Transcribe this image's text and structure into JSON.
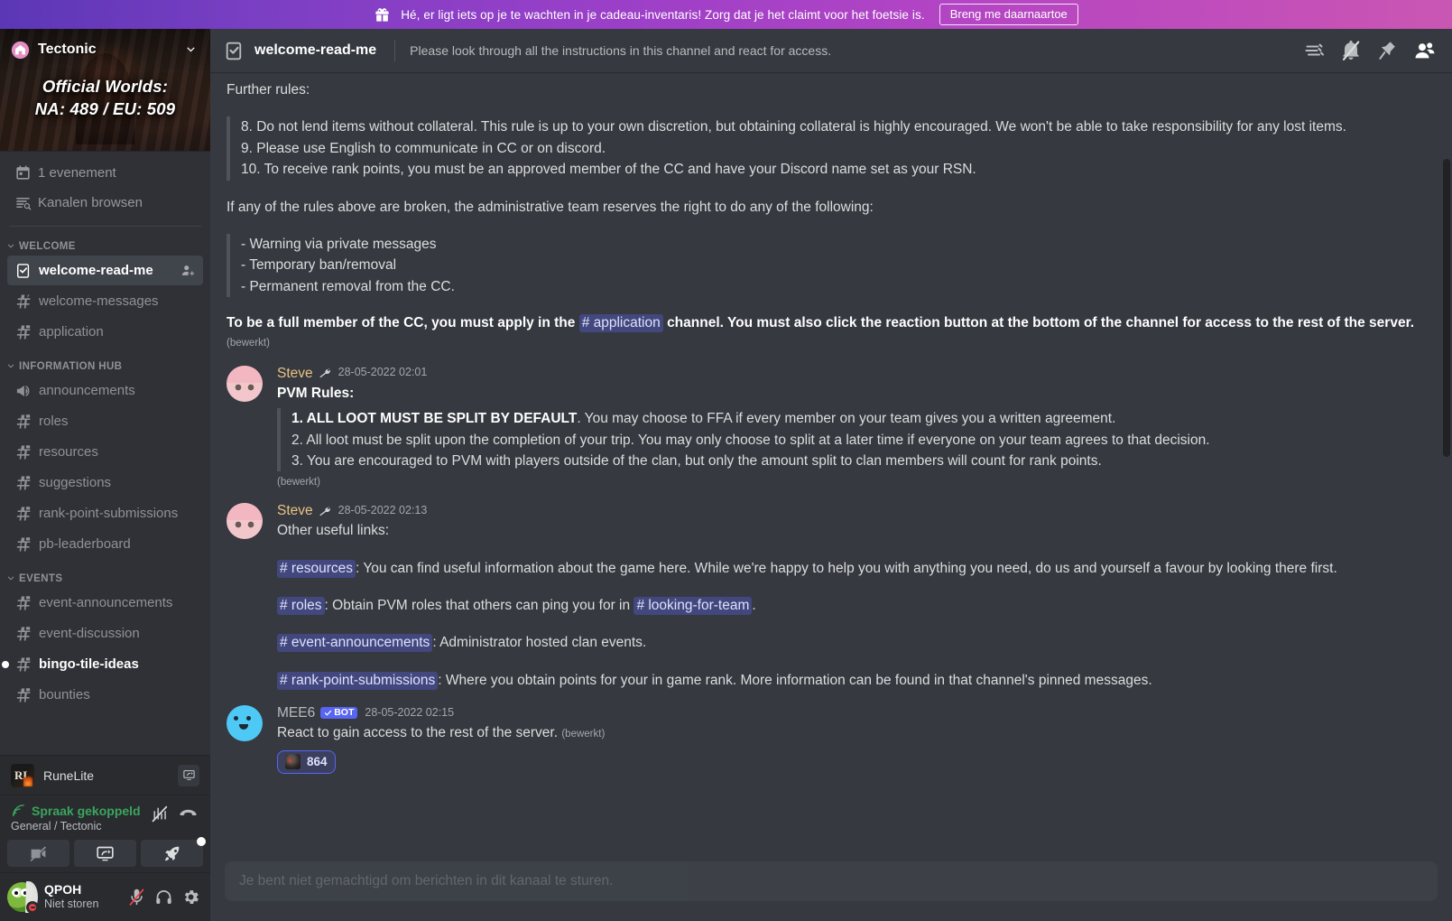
{
  "promo": {
    "icon": "gift-icon",
    "text": "Hé, er ligt iets op je te wachten in je cadeau-inventaris! Zorg dat je het claimt voor het foetsie is.",
    "button_label": "Breng me daarnaartoe"
  },
  "sidebar": {
    "guild_name": "Tectonic",
    "banner_overlay_line1": "Official Worlds:",
    "banner_overlay_line2": "NA: 489 / EU: 509",
    "nav": [
      {
        "label": "1 evenement",
        "icon": "calendar-icon"
      },
      {
        "label": "Kanalen browsen",
        "icon": "browse-channels-icon"
      }
    ],
    "categories": [
      {
        "name": "WELCOME",
        "channels": [
          {
            "label": "welcome-read-me",
            "icon": "rules-channel-icon",
            "active": true,
            "unread": false,
            "trailing_icon": "add-member-icon"
          },
          {
            "label": "welcome-messages",
            "icon": "hash-icon",
            "active": false,
            "unread": false
          },
          {
            "label": "application",
            "icon": "hash-locked-icon",
            "active": false,
            "unread": false
          }
        ]
      },
      {
        "name": "INFORMATION HUB",
        "channels": [
          {
            "label": "announcements",
            "icon": "announcement-icon",
            "active": false,
            "unread": false
          },
          {
            "label": "roles",
            "icon": "hash-locked-icon",
            "active": false,
            "unread": false
          },
          {
            "label": "resources",
            "icon": "hash-locked-icon",
            "active": false,
            "unread": false
          },
          {
            "label": "suggestions",
            "icon": "hash-locked-icon",
            "active": false,
            "unread": false
          },
          {
            "label": "rank-point-submissions",
            "icon": "hash-locked-icon",
            "active": false,
            "unread": false
          },
          {
            "label": "pb-leaderboard",
            "icon": "hash-locked-icon",
            "active": false,
            "unread": false
          }
        ]
      },
      {
        "name": "EVENTS",
        "channels": [
          {
            "label": "event-announcements",
            "icon": "hash-locked-icon",
            "active": false,
            "unread": false
          },
          {
            "label": "event-discussion",
            "icon": "hash-locked-icon",
            "active": false,
            "unread": false
          },
          {
            "label": "bingo-tile-ideas",
            "icon": "hash-locked-icon",
            "active": false,
            "unread": true
          },
          {
            "label": "bounties",
            "icon": "hash-locked-icon",
            "active": false,
            "unread": false
          }
        ]
      }
    ],
    "activity": {
      "name": "RuneLite",
      "action_icon": "popout-icon"
    },
    "voice": {
      "status": "Spraak gekoppeld",
      "channel": "General / Tectonic",
      "icons": [
        "signal-off-icon",
        "disconnect-icon"
      ],
      "buttons": [
        "video-off-icon",
        "screenshare-icon",
        "activity-rocket-icon"
      ]
    },
    "user": {
      "name": "QPOH",
      "status": "Niet storen",
      "icons": [
        "mic-muted-icon",
        "headphones-icon",
        "settings-gear-icon"
      ]
    }
  },
  "header": {
    "channel_icon": "rules-channel-icon",
    "channel_name": "welcome-read-me",
    "topic": "Please look through all the instructions in this channel and react for access.",
    "tools": [
      "threads-icon",
      "notifications-muted-icon",
      "pinned-messages-icon",
      "member-list-icon"
    ]
  },
  "messages": {
    "top_fragment": {
      "intro": "Further rules:",
      "rules": [
        "8. Do not lend items without collateral. This rule is up to your own discretion, but obtaining collateral is highly encouraged. We won't be able to take responsibility for any lost items.",
        "9. Please use English to communicate in CC or on discord.",
        "10. To receive rank points, you must be an approved member of the CC and have your Discord name set as your RSN."
      ],
      "consequences_intro": "If any of the rules above are broken, the administrative team reserves the right to do any of the following:",
      "consequences": [
        "- Warning via private messages",
        "- Temporary ban/removal",
        "- Permanent removal from the CC."
      ],
      "closing_before_mention": "To be a full member of the CC, you must apply in the",
      "closing_mention": "# application",
      "closing_after_mention": "channel.  You must also click the reaction button at the bottom of the channel for access to the rest of the server.",
      "edited_label": "(bewerkt)"
    },
    "items": [
      {
        "author": "Steve",
        "author_color": "#e6c384",
        "author_emoji": "🔧",
        "timestamp": "28-05-2022 02:01",
        "avatar": "anime-pink-avatar",
        "heading": "PVM Rules:",
        "quote_lines": [
          {
            "bold_prefix": "1. ALL LOOT MUST BE SPLIT BY DEFAULT",
            "rest": ". You may choose to FFA if every member on your team gives you a written agreement."
          },
          {
            "bold_prefix": "",
            "rest": "2. All loot must be split upon the completion of your trip. You may only choose to split at a later time if everyone on your team agrees to that decision."
          },
          {
            "bold_prefix": "",
            "rest": "3. You are encouraged to PVM with players outside of the clan, but only the amount split to clan members will count for rank points."
          }
        ],
        "edited_label": "(bewerkt)"
      },
      {
        "author": "Steve",
        "author_color": "#e6c384",
        "author_emoji": "🔧",
        "timestamp": "28-05-2022 02:13",
        "avatar": "anime-pink-avatar",
        "heading": "Other useful links:",
        "links": [
          {
            "mention": "# resources",
            "text": ": You can find useful information about the game here. While we're happy to help you with anything you need, do us and yourself a favour by looking there first."
          },
          {
            "mention": "# roles",
            "text": ": Obtain PVM roles that others can ping you for in ",
            "mention2": "# looking-for-team",
            "text2": "."
          },
          {
            "mention": "# event-announcements",
            "text": ": Administrator hosted clan events."
          },
          {
            "mention": "# rank-point-submissions",
            "text": ": Where you obtain points for your in game rank. More information can be found in that channel's pinned messages."
          }
        ]
      },
      {
        "author": "MEE6",
        "author_color": "#b9bbbe",
        "bot_tag": "BOT",
        "timestamp": "28-05-2022 02:15",
        "avatar": "mee6-avatar",
        "text": "React to gain access to the rest of the server.",
        "edited_label": "(bewerkt)",
        "reaction": {
          "emoji": "dark-helmet-emoji",
          "count": "864"
        }
      }
    ]
  },
  "composer": {
    "disabled_notice": "Je bent niet gemachtigd om berichten in dit kanaal te sturen."
  },
  "colors": {
    "brand_blurple": "#5865f2",
    "online_green": "#3ba55d",
    "dnd_red": "#ed4245",
    "author_gold": "#e6c384"
  }
}
